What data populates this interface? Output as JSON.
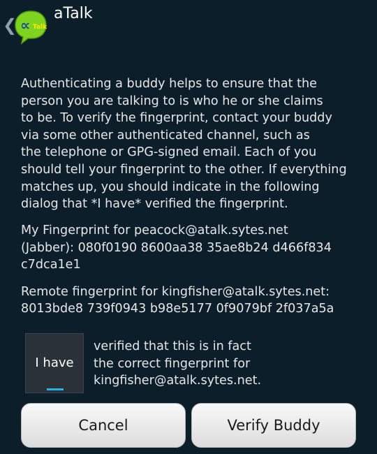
{
  "app": {
    "title": "aTalk",
    "logo_text": "Talk"
  },
  "dialog": {
    "intro_lines": [
      "Authenticating a buddy helps to ensure that the",
      "person you are talking to is who he or she claims",
      "to be. To verify the fingerprint, contact your buddy",
      "via some other authenticated channel, such as",
      "the telephone or GPG-signed email. Each of you",
      "should tell your fingerprint to the other. If everything",
      "matches up, you should indicate in the following",
      "dialog that *I have* verified the fingerprint."
    ],
    "my_fingerprint_lines": [
      "My Fingerprint for peacock@atalk.sytes.net",
      "(Jabber): 080f0190 8600aa38 35ae8b24 d466f834",
      "c7dca1e1"
    ],
    "remote_fingerprint_lines": [
      "Remote fingerprint for kingfisher@atalk.sytes.net:",
      "8013bde8 739f0943 b98e5177 0f9079bf 2f037a5a"
    ],
    "toggle_label": "I have",
    "verify_text_lines": [
      "verified that this is in fact",
      "the correct fingerprint for",
      "kingfisher@atalk.sytes.net."
    ]
  },
  "buttons": {
    "cancel_label": "Cancel",
    "verify_label": "Verify Buddy"
  },
  "colors": {
    "background": "#0d1e2b",
    "accent": "#27b2e4",
    "logo_green": "#7ed321"
  }
}
